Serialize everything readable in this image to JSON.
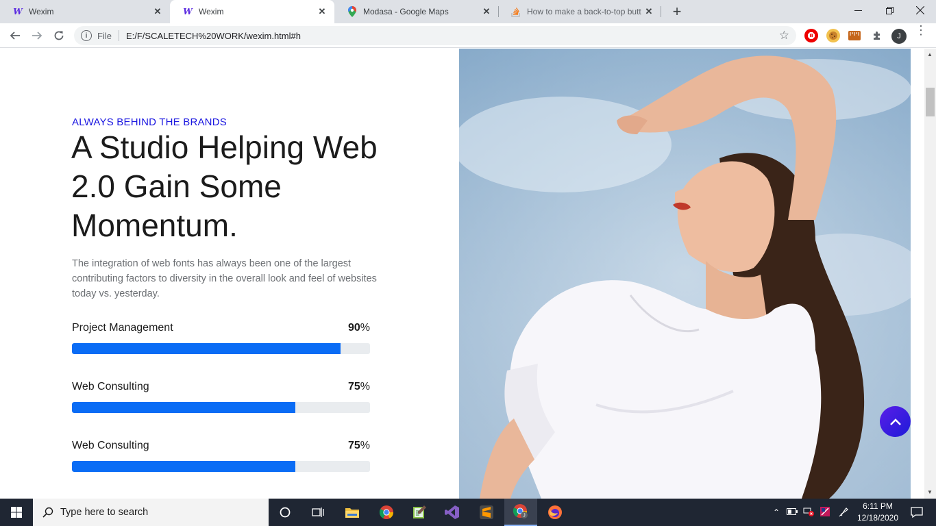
{
  "browser": {
    "tabs": [
      {
        "title": "Wexim",
        "favicon": "wexim-w-icon",
        "active": false
      },
      {
        "title": "Wexim",
        "favicon": "wexim-w-icon",
        "active": true
      },
      {
        "title": "Modasa - Google Maps",
        "favicon": "google-maps-pin-icon",
        "active": false
      },
      {
        "title": "How to make a back-to-top butt",
        "favicon": "stackoverflow-icon",
        "active": false
      }
    ],
    "address": {
      "scheme": "File",
      "url": "E:/F/SCALETECH%20WORK/wexim.html#h"
    },
    "profile_initial": "J"
  },
  "page": {
    "eyebrow": "ALWAYS BEHIND THE BRANDS",
    "headline": "A Studio Helping Web 2.0 Gain Some Momentum.",
    "lead": "The integration of web fonts has always been one of the largest contributing factors to diversity in the overall look and feel of websites today vs. yesterday.",
    "skills": [
      {
        "label": "Project Management",
        "value": "90",
        "unit": "%",
        "percent": 90
      },
      {
        "label": "Web Consulting",
        "value": "75",
        "unit": "%",
        "percent": 75
      },
      {
        "label": "Web Consulting",
        "value": "75",
        "unit": "%",
        "percent": 75
      }
    ],
    "accent_color": "#0a6cf5",
    "eyebrow_color": "#1a16e0"
  },
  "taskbar": {
    "search_placeholder": "Type here to search",
    "time": "6:11 PM",
    "date": "12/18/2020"
  }
}
